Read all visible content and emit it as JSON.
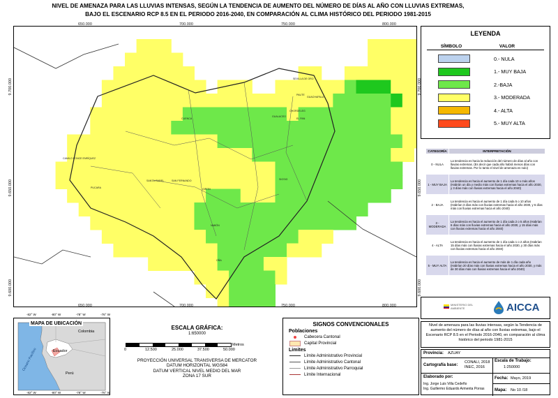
{
  "title_lines": [
    "NIVEL DE AMENAZA PARA LAS LLUVIAS INTENSAS, SEGÚN LA TENDENCIA DE AUMENTO DEL NÚMERO DE DÍAS AL AÑO CON LLUVIAS EXTREMAS,",
    "BAJO EL ESCENARIO RCP 8.5 EN EL PERIODO 2016-2040, EN COMPARACIÓN AL CLIMA HISTÓRICO DEL PERIODO 1981-2015"
  ],
  "map": {
    "x_ticks": [
      "650.000",
      "700.000",
      "750.000",
      "800.000"
    ],
    "y_ticks": [
      "9.700.000",
      "9.650.000",
      "9.600.000"
    ],
    "place_labels": [
      "SEVILLA DE ORO",
      "PAUTE",
      "GUACHAPALA",
      "CHORDELEG",
      "GUALACEO",
      "EL PAN",
      "CUENCA",
      "SIGSIG",
      "CAMILO PONCE ENRÍQUEZ",
      "PUCARA",
      "SANTA ISABEL",
      "SAN FERNANDO",
      "GIRON",
      "NABÓN",
      "OÑA"
    ]
  },
  "legend": {
    "title": "LEYENDA",
    "col_symbol": "SÍMBOLO",
    "col_value": "VALOR",
    "items": [
      {
        "label": "0.- NULA",
        "color": "#bcd2ee"
      },
      {
        "label": "1.- MUY BAJA",
        "color": "#1ec81e"
      },
      {
        "label": "2.-BAJA",
        "color": "#6ee84a"
      },
      {
        "label": "3.- MODERADA",
        "color": "#ffff66"
      },
      {
        "label": "4.- ALTA",
        "color": "#f5b800"
      },
      {
        "label": "5.- MUY ALTA",
        "color": "#ff4a1c"
      }
    ]
  },
  "interpretation": {
    "col_category": "CATEGORÍA",
    "col_interpretation": "INTERPRETACIÓN",
    "rows": [
      {
        "cat": "0 - NULA",
        "text": "La tendencia es hacia la reducción del número de días al año con lluvias extremas. (Es decir que cada año habrá menos días con lluvias extremas. Por lo tanto el nivel de amenaza es nulo)"
      },
      {
        "cat": "1 - MUY BAJA",
        "text": "La tendencia es hacia el aumento de 1 día cada 10 o más años (Habrán un día y medio más con lluvias extremas hacia el año 2030, y 3 días más con lluvias extremas hacia el año 2040)"
      },
      {
        "cat": "2 - BAJA",
        "text": "La tendencia es hacia el aumento de 1 día cada 5 o 10 años (Habrían 3 días más con lluvias extremas hacia el año 2030, y 6 días más con lluvias extremas hacia el año 2040)"
      },
      {
        "cat": "3 - MODERADA",
        "text": "La tendencia es hacia el aumento de 1 día cada 2 o 5 años (Habrían 6 días más con lluvias extremas hacia el año 2030, y 15 días más con lluvias extremas hacia el año 2040)"
      },
      {
        "cat": "4 - ALTA",
        "text": "La tendencia es hacia el aumento de 1 día cada 1 o 2 años (Habrían 15 días más con lluvias extremas hacia el año 2030, y 30 días más con lluvias extremas hacia el año 2040)"
      },
      {
        "cat": "5 - MUY ALTA",
        "text": "La tendencia es hacia el aumento de más de 1 día cada año (Habrían 20 días más con lluvias extremas hacia el año 2030, y más de 30 días más con lluvias extremas hacia el año 2040)"
      }
    ]
  },
  "logos": {
    "ministerio": "MINISTERIO DEL AMBIENTE",
    "aicca": "AICCA"
  },
  "description": "Nivel de amenaza para las lluvias intensas, según la Tendencia de aumento del número de días al año con lluvias extremas, bajo el Escenario RCP 8.5 en el Periodo 2016-2040, en comparación al clima histórico del periodo 1981-2015",
  "info": {
    "provincia_label": "Provincia:",
    "provincia": "AZUAY",
    "cartografia_label": "Cartografía base:",
    "cartografia": "CONALI, 2018\nINEC, 2016",
    "escala_label": "Escala de Trabajo:",
    "escala": "1:250000",
    "elaborado_label": "Elaborado por:",
    "autores": [
      "Ing. Jorge Luis Villa Cedeño",
      "Ing. Guillermo Eduardo Armenta Porras"
    ],
    "fecha_label": "Fecha:",
    "fecha": "Mayo, 2019",
    "mapa_label": "Mapa:",
    "mapa": "No 10 /18"
  },
  "ubicacion": {
    "title": "MAPA DE UBICACIÓN",
    "labels": {
      "colombia": "Colombia",
      "ecuador": "Ecuador",
      "peru": "Perú",
      "ocean": "Oceano Pacífico"
    },
    "top_ticks": [
      "-82° W",
      "-80° W",
      "-78° W",
      "-76° W"
    ],
    "bottom_ticks": [
      "-82° W",
      "-80° W",
      "-78° W",
      "-76° W"
    ]
  },
  "escala_grafica": {
    "title": "ESCALA GRÁFICA:",
    "ratio": "1:650000",
    "ticks": [
      "0",
      "12.500",
      "25.000",
      "37.500",
      "50.000"
    ],
    "unit": "Metros",
    "proj_lines": [
      "PROYECCIÓN UNIVERSAL TRANSVERSA DE MERCATOR",
      "DATUM HORIZONTAL WGS84",
      "DATUM VERTICAL NIVEL MEDIO DEL MAR",
      "ZONA 17 SUR"
    ]
  },
  "signos": {
    "title": "SIGNOS CONVENCIONALES",
    "poblaciones": "Poblaciones",
    "cabecera": "Cabecera Cantonal",
    "capital": "Capital Provincial",
    "limites": "Limites",
    "lim_prov": "Límite Administrativo Provincial",
    "lim_cant": "Límite Administrativo Cantonal",
    "lim_parr": "Límite Administrativo Parroquial",
    "lim_int": "Límite Internacional"
  }
}
